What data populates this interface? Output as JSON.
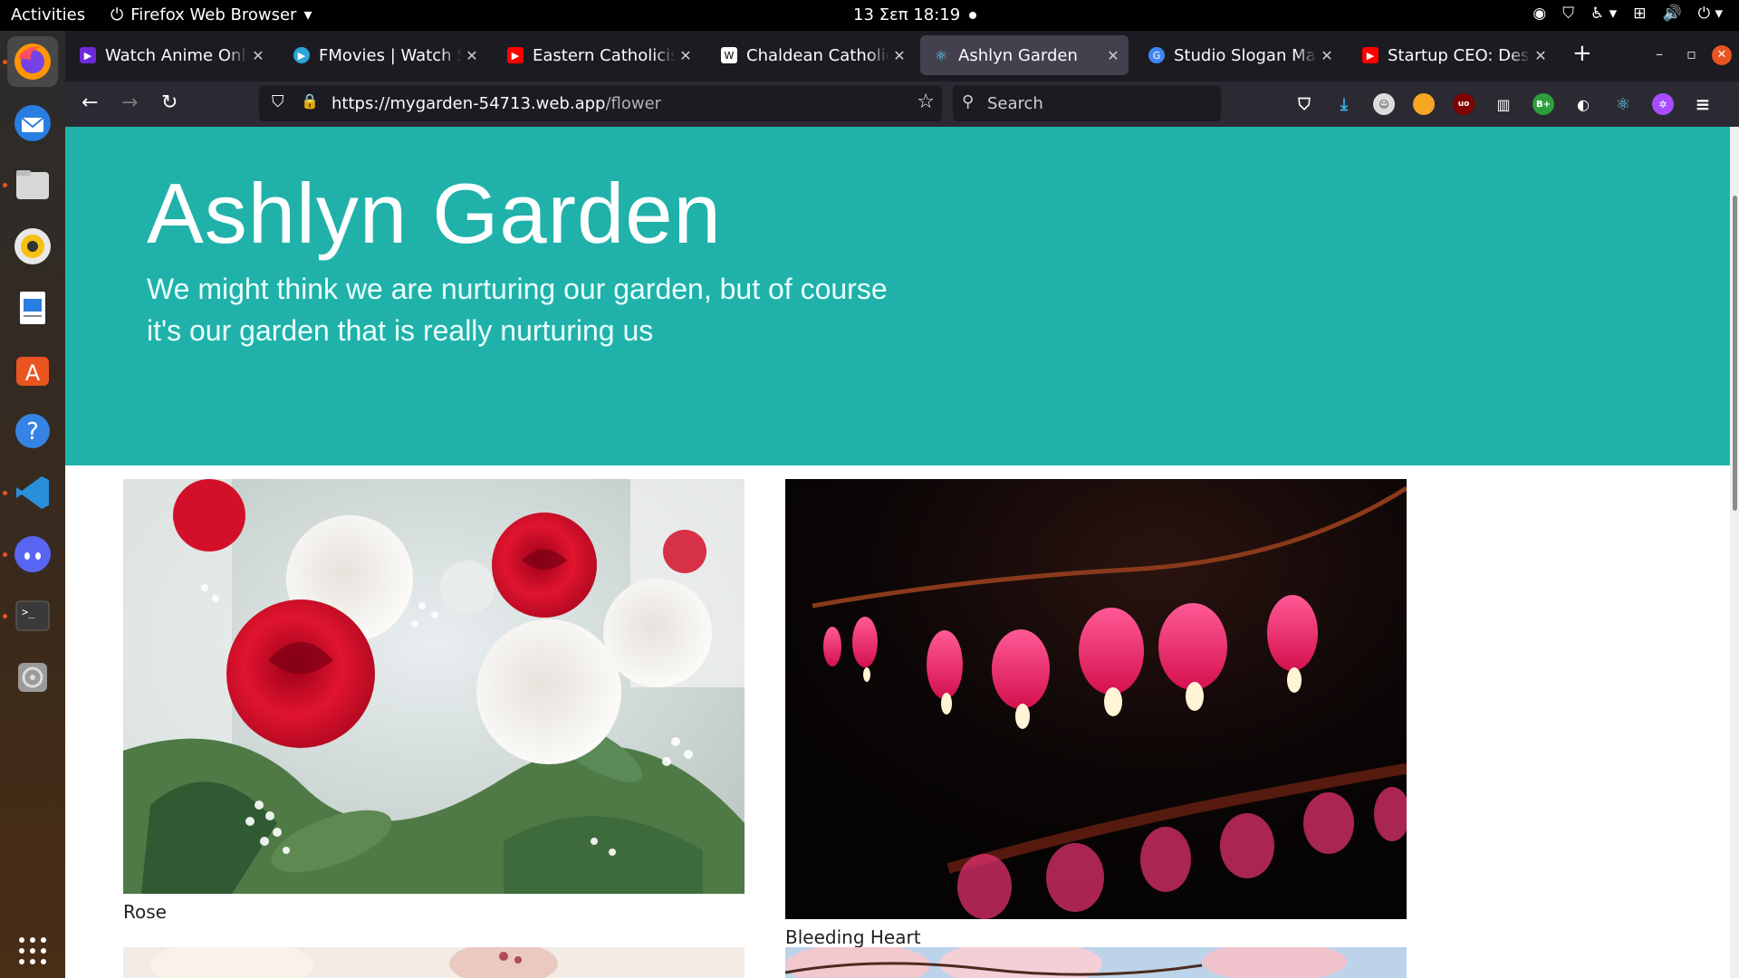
{
  "system": {
    "activities": "Activities",
    "app_name": "Firefox Web Browser",
    "clock": "13 Σεπ  18:19"
  },
  "tabs": [
    {
      "label": "Watch Anime Online",
      "icon": "play-icon",
      "color": "#8a2be2"
    },
    {
      "label": "FMovies | Watch Super",
      "icon": "fmovies-icon",
      "color": "#2aa6d8"
    },
    {
      "label": "Eastern Catholicism",
      "icon": "youtube-icon",
      "color": "#ff0000"
    },
    {
      "label": "Chaldean Catholic Church",
      "icon": "wikipedia-icon",
      "color": "#ffffff"
    },
    {
      "label": "Ashlyn Garden",
      "icon": "react-icon",
      "color": "#61dafb",
      "active": true
    },
    {
      "label": "Studio Slogan Maker",
      "icon": "google-icon",
      "color": "#4285f4"
    },
    {
      "label": "Startup CEO: Design",
      "icon": "youtube-icon",
      "color": "#ff0000"
    }
  ],
  "address": {
    "url_host": "https://mygarden-54713.web.app",
    "url_path": "/flower",
    "search_placeholder": "Search"
  },
  "hero": {
    "title": "Ashlyn Garden",
    "tagline": "We might think we are nurturing our garden, but of course it's our garden that is really nurturing us",
    "background": "#20b2aa"
  },
  "flowers": [
    {
      "name": "Rose"
    },
    {
      "name": "Bleeding Heart"
    }
  ]
}
